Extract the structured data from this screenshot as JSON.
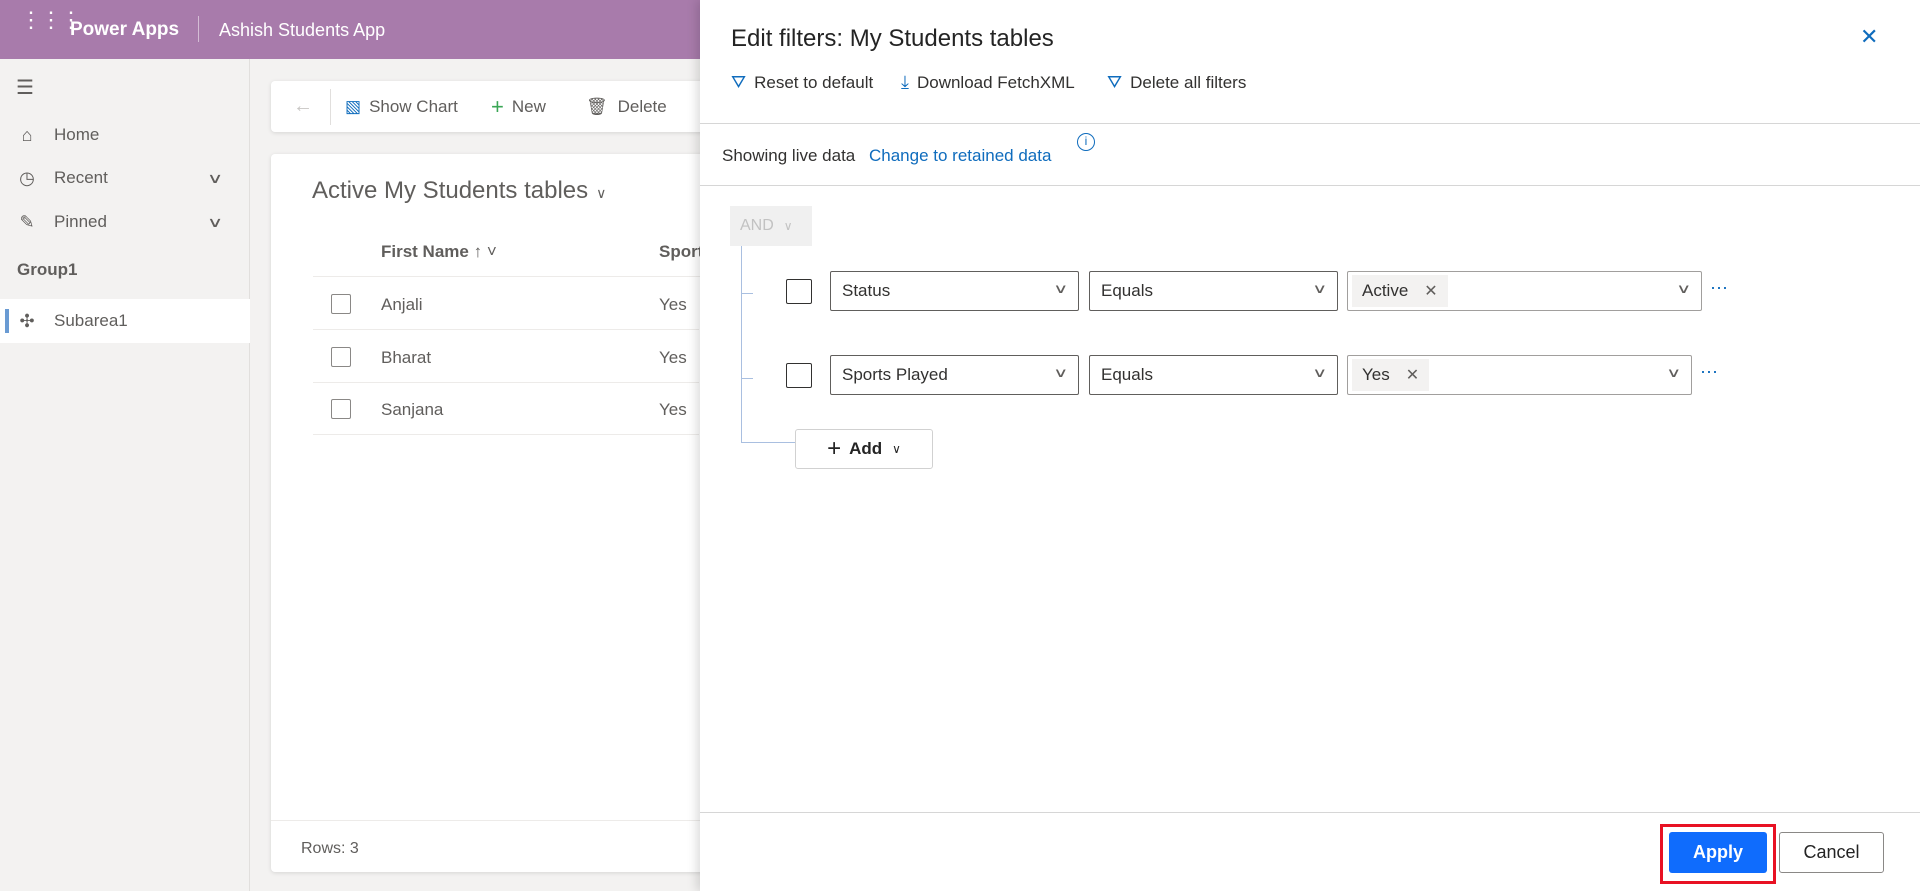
{
  "header": {
    "brand": "Power Apps",
    "app_name": "Ashish Students App"
  },
  "sidebar": {
    "items": [
      {
        "label": "Home"
      },
      {
        "label": "Recent"
      },
      {
        "label": "Pinned"
      }
    ],
    "group": "Group1",
    "subarea": "Subarea1"
  },
  "commandbar": {
    "show_chart": "Show Chart",
    "new": "New",
    "delete": "Delete"
  },
  "grid": {
    "view_title": "Active My Students tables",
    "columns": [
      "First Name",
      "Sport"
    ],
    "rows": [
      {
        "first_name": "Anjali",
        "sport": "Yes"
      },
      {
        "first_name": "Bharat",
        "sport": "Yes"
      },
      {
        "first_name": "Sanjana",
        "sport": "Yes"
      }
    ],
    "footer": "Rows: 3"
  },
  "panel": {
    "title": "Edit filters: My Students tables",
    "toolbar": {
      "reset": "Reset to default",
      "download": "Download FetchXML",
      "delete_all": "Delete all filters"
    },
    "live_text": "Showing live data",
    "retained_link": "Change to retained data",
    "group_operator": "AND",
    "conditions": [
      {
        "field": "Status",
        "operator": "Equals",
        "value": "Active"
      },
      {
        "field": "Sports Played",
        "operator": "Equals",
        "value": "Yes"
      }
    ],
    "add_label": "Add",
    "apply": "Apply",
    "cancel": "Cancel"
  },
  "colors": {
    "header": "#a87bab",
    "accent": "#0f6cbd",
    "apply": "#0f6cfd",
    "highlight": "#e81123"
  }
}
